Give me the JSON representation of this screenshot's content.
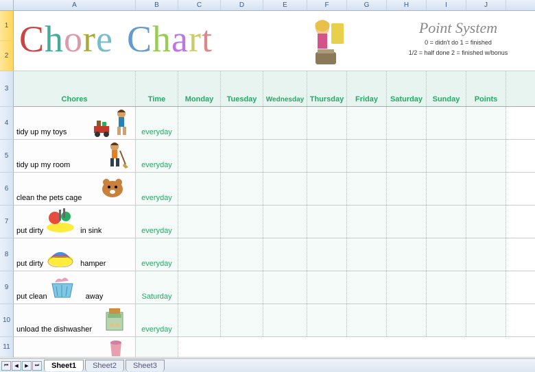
{
  "columns": [
    "A",
    "B",
    "C",
    "D",
    "E",
    "F",
    "G",
    "H",
    "I",
    "J"
  ],
  "row_numbers": [
    "1",
    "2",
    "3",
    "4",
    "5",
    "6",
    "7",
    "8",
    "9",
    "10",
    "11"
  ],
  "title": "Chore Chart",
  "point_system": {
    "title": "Point System",
    "line1": "0 = didn't do   1 = finished",
    "line2": "1/2 = half done   2 = finished w/bonus"
  },
  "headers": {
    "chores": "Chores",
    "time": "Time",
    "days": [
      "Monday",
      "Tuesday",
      "Wednesday",
      "Thursday",
      "Friday",
      "Saturday",
      "Sunday"
    ],
    "points": "Points"
  },
  "chores": [
    {
      "name": "tidy up my toys",
      "time": "everyday",
      "icon": "wagon-boy"
    },
    {
      "name": "tidy up my room",
      "time": "everyday",
      "icon": "broom-boy"
    },
    {
      "name": "clean the pets cage",
      "time": "everyday",
      "icon": "hamster"
    },
    {
      "name_pre": "put dirty",
      "name_post": "in sink",
      "time": "everyday",
      "icon": "dishes"
    },
    {
      "name_pre": "put dirty",
      "name_post": "hamper",
      "time": "everyday",
      "icon": "laundry"
    },
    {
      "name_pre": "put clean",
      "name_post": "away",
      "time": "Saturday",
      "icon": "basket"
    },
    {
      "name": "unload the dishwasher",
      "time": "everyday",
      "icon": "dishwasher"
    }
  ],
  "sheets": [
    "Sheet1",
    "Sheet2",
    "Sheet3"
  ],
  "active_sheet": 0
}
